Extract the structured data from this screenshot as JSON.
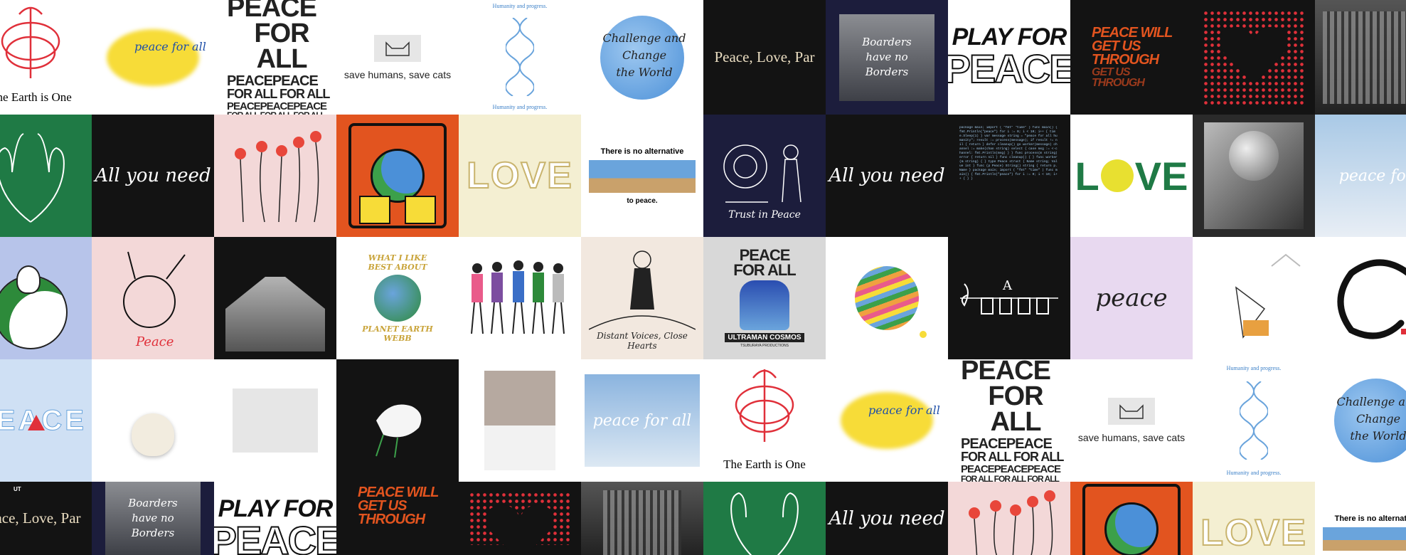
{
  "tiles": {
    "earth_one": "The Earth is One",
    "peace_for_all": [
      "PEACE",
      "FOR ALL",
      "PEACEPEACE",
      "FOR ALL FOR ALL",
      "PEACEPEACEPEACE",
      "FOR ALL FOR ALL FOR ALL"
    ],
    "save_cats": "save humans, save cats",
    "humanity_top": "Humanity and progress.",
    "humanity_bottom": "Humanity and progress.",
    "challenge": [
      "Challenge and Change",
      "the World"
    ],
    "peace_love": "Peace, Love, Par",
    "borders": [
      "Boarders",
      "have no",
      "Borders"
    ],
    "play_for": "PLAY FOR",
    "peace_word": "PEACE",
    "peace_will": [
      "PEACE WILL",
      "GET US",
      "THROUGH"
    ],
    "all_you_need": "All you need",
    "no_alternative": "There is no alternative",
    "to_peace": "to peace.",
    "trust_in_peace": "Trust in Peace",
    "love": [
      "L",
      "V",
      "E"
    ],
    "peace_script": "peace for",
    "peace_rabbit": "Peace",
    "webb": [
      "WHAT I LIKE",
      "BEST ABOUT",
      "PLANET EARTH",
      "WEBB"
    ],
    "distant_voices": "Distant Voices, Close Hearts",
    "peace_for_all_grey": [
      "PEACE",
      "FOR ALL"
    ],
    "ultraman": "ULTRAMAN COSMOS",
    "tsuburaya": "TSUBURAYA PRODUCTIONS",
    "peace_pink": "peace",
    "peace_big": "PEACE",
    "peace_for_all_script": "peace for all",
    "uniqlo_tag": "UT"
  },
  "colors": {
    "green": "#1f7a45",
    "black": "#131313",
    "navy": "#1c1d3c",
    "orange": "#e2541f",
    "pink": "#f3d8d8",
    "cream": "#f4efd2",
    "lavender": "#e8d9f0",
    "grey": "#d8d8d8",
    "red": "#e0303a",
    "blue": "#6aa4dc",
    "yellow": "#f7dc38"
  }
}
